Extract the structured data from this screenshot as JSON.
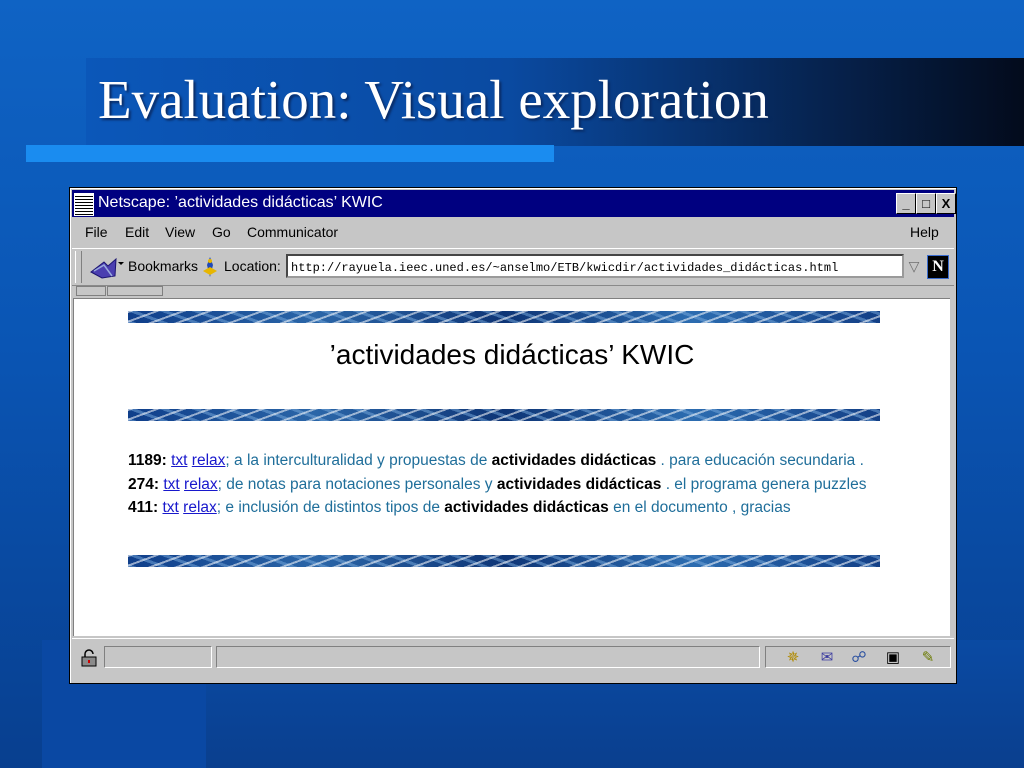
{
  "slide": {
    "title": "Evaluation: Visual exploration"
  },
  "window": {
    "title": "Netscape: ’actividades didácticas’ KWIC",
    "controls": {
      "minimize": "_",
      "maximize": "□",
      "close": "X"
    }
  },
  "menu": {
    "left": [
      "File",
      "Edit",
      "View",
      "Go",
      "Communicator"
    ],
    "right": "Help"
  },
  "toolbar": {
    "bookmarks_label": "Bookmarks",
    "location_label": "Location:",
    "url": "http://rayuela.ieec.uned.es/~anselmo/ETB/kwicdir/actividades_didácticas.html",
    "logo_letter": "N"
  },
  "page": {
    "heading": "’actividades didácticas’ KWIC",
    "results": [
      {
        "num": "1189:",
        "txt_link": "txt",
        "relax_link": "relax",
        "left": "; a la interculturalidad y propuestas de ",
        "term": "actividades didácticas",
        "right": " . para educación secundaria ."
      },
      {
        "num": "274:",
        "txt_link": "txt",
        "relax_link": "relax",
        "left": "; de notas para notaciones personales y ",
        "term": "actividades didácticas",
        "right": " . el programa genera puzzles"
      },
      {
        "num": "411:",
        "txt_link": "txt",
        "relax_link": "relax",
        "left": "; e inclusión de distintos tipos de ",
        "term": "actividades didácticas",
        "right": " en el documento , gracias"
      }
    ]
  },
  "icons": {
    "bookmarks": "bookmarks-icon",
    "location": "location-icon",
    "security": "lock-icon",
    "component_bar": [
      "navigator-icon",
      "mail-icon",
      "discussions-icon",
      "composer-icon",
      "edit-icon"
    ]
  },
  "colors": {
    "window_titlebar": "#000080",
    "link": "#1818cc",
    "context_text": "#1f6e9a"
  }
}
